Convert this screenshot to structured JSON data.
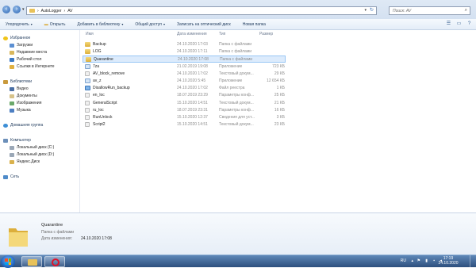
{
  "address": {
    "segments": [
      "AutoLogger",
      "AV"
    ],
    "search_placeholder": "Поиск: AV"
  },
  "toolbar": {
    "organize": "Упорядочить",
    "open": "Открыть",
    "add_to_library": "Добавить в библиотеку",
    "share": "Общий доступ",
    "burn": "Записать на оптический диск",
    "new_folder": "Новая папка"
  },
  "nav": {
    "favorites": "Избранное",
    "downloads": "Загрузки",
    "recent": "Недавние места",
    "desktop": "Рабочий стол",
    "links": "Ссылки в Интернете",
    "libraries": "Библиотеки",
    "video": "Видео",
    "documents": "Документы",
    "images": "Изображения",
    "music": "Музыка",
    "homegroup": "Домашняя группа",
    "computer": "Компьютер",
    "disk_c": "Локальный диск (C:)",
    "disk_d": "Локальный диск (D:)",
    "yandex": "Яндекс.Диск",
    "network": "Сеть"
  },
  "columns": {
    "name": "Имя",
    "date": "Дата изменения",
    "type": "Тип",
    "size": "Размер"
  },
  "files": [
    {
      "name": "Backup",
      "date": "24.10.2020 17:03",
      "type": "Папка с файлами",
      "size": "",
      "icon": "folder"
    },
    {
      "name": "LOG",
      "date": "24.10.2020 17:11",
      "type": "Папка с файлами",
      "size": "",
      "icon": "folder"
    },
    {
      "name": "Quarantine",
      "date": "24.10.2020 17:08",
      "type": "Папка с файлами",
      "size": "",
      "icon": "folder"
    },
    {
      "name": "7za",
      "date": "21.02.2019 19:08",
      "type": "Приложение",
      "size": "723 КБ",
      "icon": "exe"
    },
    {
      "name": "AV_block_remove",
      "date": "24.10.2020 17:02",
      "type": "Текстовый докум...",
      "size": "29 КБ",
      "icon": "file"
    },
    {
      "name": "av_z",
      "date": "24.10.2020 5:45",
      "type": "Приложение",
      "size": "12 654 КБ",
      "icon": "exe"
    },
    {
      "name": "DisallowRun_backup",
      "date": "24.10.2020 17:02",
      "type": "Файл реестра",
      "size": "1 КБ",
      "icon": "reg"
    },
    {
      "name": "en_loc",
      "date": "18.07.2019 23:29",
      "type": "Параметры конф...",
      "size": "25 КБ",
      "icon": "file"
    },
    {
      "name": "GeneralScript",
      "date": "15.10.2020 14:51",
      "type": "Текстовый докум...",
      "size": "21 КБ",
      "icon": "file"
    },
    {
      "name": "ru_loc",
      "date": "18.07.2019 23:31",
      "type": "Параметры конф...",
      "size": "16 КБ",
      "icon": "file"
    },
    {
      "name": "RunUnlock",
      "date": "15.10.2020 12:37",
      "type": "Сведения для уст...",
      "size": "3 КБ",
      "icon": "file"
    },
    {
      "name": "Script2",
      "date": "15.10.2020 14:51",
      "type": "Текстовый докум...",
      "size": "23 КБ",
      "icon": "file"
    }
  ],
  "details": {
    "name": "Quarantine",
    "type": "Папка с файлами",
    "date_label": "Дата изменения:",
    "date_value": "24.10.2020 17:08"
  },
  "taskbar": {
    "lang": "RU",
    "time": "17:19",
    "date": "24.10.2020"
  },
  "colors": {
    "selection": "#dcebfc",
    "taskbar": "#2d4f7d"
  }
}
